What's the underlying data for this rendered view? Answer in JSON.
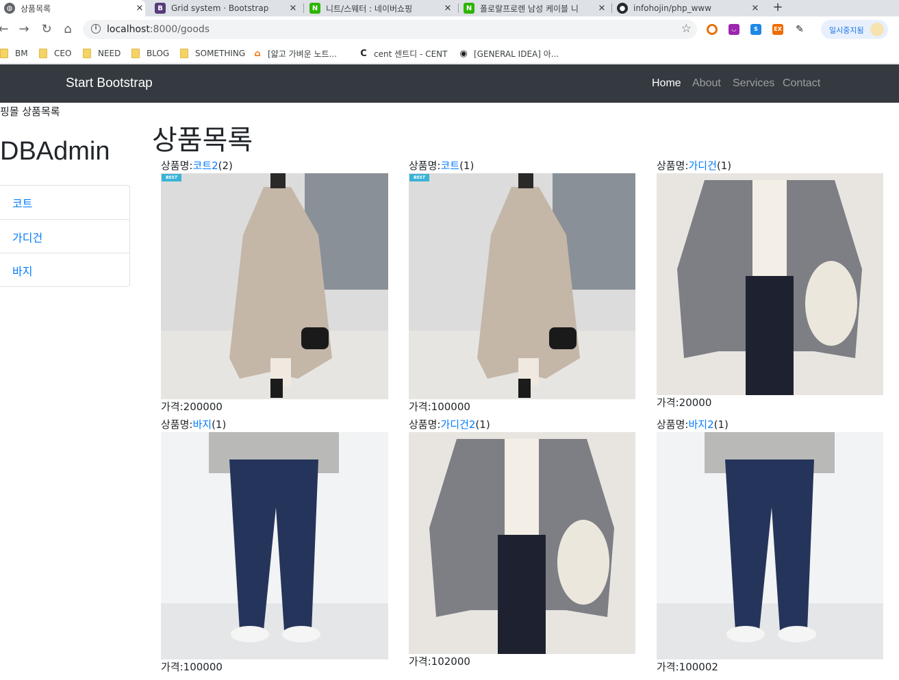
{
  "browser": {
    "tabs": [
      {
        "title": "상품목록",
        "active": true
      },
      {
        "title": "Grid system · Bootstrap",
        "icon": "B"
      },
      {
        "title": "니트/스웨터 : 네이버쇼핑"
      },
      {
        "title": "폴로랄프로렌 남성 케이블 니"
      },
      {
        "title": "infohojin/php_www"
      }
    ],
    "url_host": "localhost",
    "url_path": ":8000/goods",
    "profile_status": "일시중지됨",
    "bookmarks": [
      "BM",
      "CEO",
      "NEED",
      "BLOG",
      "SOMETHING",
      "[얇고 가벼운 노트...",
      "cent 센트디 - CENT",
      "[GENERAL IDEA] 아..."
    ]
  },
  "navbar": {
    "brand": "Start Bootstrap",
    "links": [
      "Home",
      "About",
      "Services",
      "Contact"
    ]
  },
  "breadcrumb": "핑몰 상품목록",
  "sidebar": {
    "title": "DBAdmin",
    "categories": [
      "코트",
      "가디건",
      "바지"
    ]
  },
  "main": {
    "title": "상품목록",
    "name_label": "상품명:",
    "price_label": "가격:",
    "products": [
      {
        "name": "코트2",
        "count": "(2)",
        "price": "200000",
        "badge": "BEST"
      },
      {
        "name": "코트",
        "count": "(1)",
        "price": "100000",
        "badge": "BEST"
      },
      {
        "name": "가디건",
        "count": "(1)",
        "price": "20000"
      },
      {
        "name": "바지",
        "count": "(1)",
        "price": "100000"
      },
      {
        "name": "가디건2",
        "count": "(1)",
        "price": "102000"
      },
      {
        "name": "바지2",
        "count": "(1)",
        "price": "100002"
      }
    ]
  }
}
